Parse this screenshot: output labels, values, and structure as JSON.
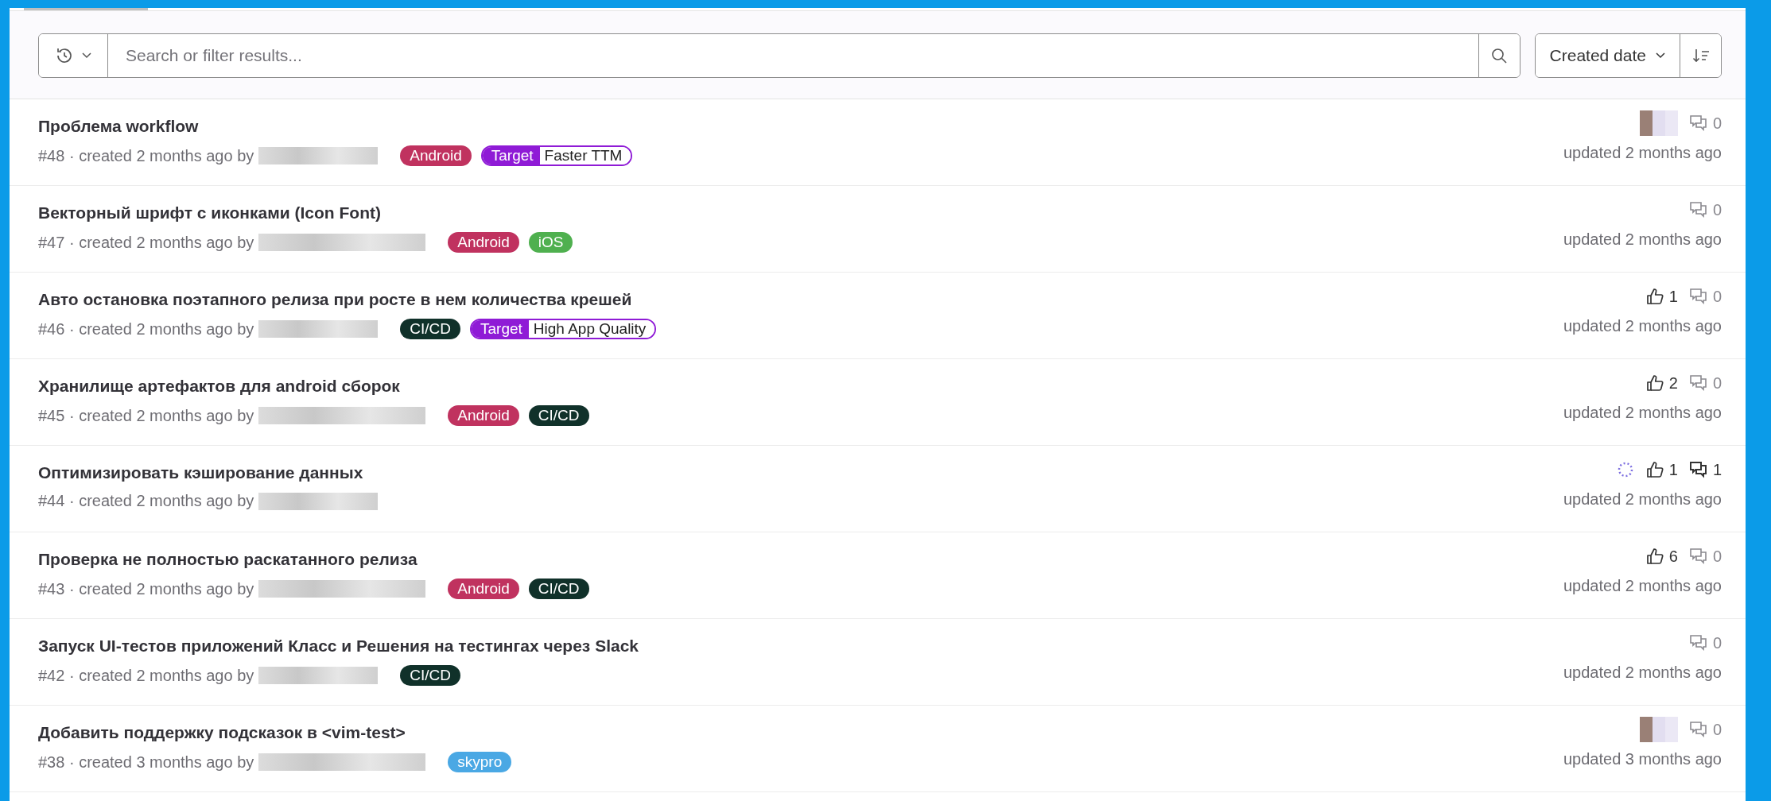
{
  "filter_bar": {
    "search": {
      "placeholder": "Search or filter results..."
    },
    "sort": {
      "label": "Created date"
    }
  },
  "issues": [
    {
      "title": "Проблема workflow",
      "number": "#48",
      "meta": "· created 2 months ago by",
      "labels": [
        {
          "kind": "plain",
          "text": "Android",
          "color": "#c0325f"
        },
        {
          "kind": "scoped",
          "scope": "Target",
          "text": "Faster TTM",
          "color": "#8f1bd6"
        }
      ],
      "assignee_avatar": true,
      "loading": false,
      "comments": "0",
      "comments_active": false,
      "updated": "updated 2 months ago"
    },
    {
      "title": "Векторный шрифт с иконками (Icon Font)",
      "number": "#47",
      "meta": "· created 2 months ago by",
      "labels": [
        {
          "kind": "plain",
          "text": "Android",
          "color": "#c0325f"
        },
        {
          "kind": "plain",
          "text": "iOS",
          "color": "#4fb04f"
        }
      ],
      "assignee_avatar": false,
      "loading": false,
      "comments": "0",
      "comments_active": false,
      "updated": "updated 2 months ago"
    },
    {
      "title": "Авто остановка поэтапного релиза при росте в нем количества крешей",
      "number": "#46",
      "meta": "· created 2 months ago by",
      "labels": [
        {
          "kind": "plain",
          "text": "CI/CD",
          "color": "#10312a"
        },
        {
          "kind": "scoped",
          "scope": "Target",
          "text": "High App Quality",
          "color": "#8f1bd6"
        }
      ],
      "assignee_avatar": false,
      "loading": false,
      "upvotes": "1",
      "comments": "0",
      "comments_active": false,
      "updated": "updated 2 months ago"
    },
    {
      "title": "Хранилище артефактов для android сборок",
      "number": "#45",
      "meta": "· created 2 months ago by",
      "labels": [
        {
          "kind": "plain",
          "text": "Android",
          "color": "#c0325f"
        },
        {
          "kind": "plain",
          "text": "CI/CD",
          "color": "#10312a"
        }
      ],
      "assignee_avatar": false,
      "loading": false,
      "upvotes": "2",
      "comments": "0",
      "comments_active": false,
      "updated": "updated 2 months ago"
    },
    {
      "title": "Оптимизировать кэширование данных",
      "number": "#44",
      "meta": "· created 2 months ago by",
      "assignee_avatar": false,
      "loading": true,
      "upvotes": "1",
      "comments": "1",
      "comments_active": true,
      "updated": "updated 2 months ago"
    },
    {
      "title": "Проверка не полностью раскатанного релиза",
      "number": "#43",
      "meta": "· created 2 months ago by",
      "labels": [
        {
          "kind": "plain",
          "text": "Android",
          "color": "#c0325f"
        },
        {
          "kind": "plain",
          "text": "CI/CD",
          "color": "#10312a"
        }
      ],
      "assignee_avatar": false,
      "loading": false,
      "upvotes": "6",
      "comments": "0",
      "comments_active": false,
      "updated": "updated 2 months ago"
    },
    {
      "title": "Запуск UI-тестов приложений Класс и Решения на тестингах через Slack",
      "number": "#42",
      "meta": "· created 2 months ago by",
      "labels": [
        {
          "kind": "plain",
          "text": "CI/CD",
          "color": "#10312a"
        }
      ],
      "assignee_avatar": false,
      "loading": false,
      "comments": "0",
      "comments_active": false,
      "updated": "updated 2 months ago"
    },
    {
      "title": "Добавить поддержку подсказок в <vim-test>",
      "number": "#38",
      "meta": "· created 3 months ago by",
      "labels": [
        {
          "kind": "plain",
          "text": "skypro",
          "color": "#4aa8e4"
        }
      ],
      "assignee_avatar": true,
      "loading": false,
      "comments": "0",
      "comments_active": false,
      "updated": "updated 3 months ago"
    }
  ]
}
